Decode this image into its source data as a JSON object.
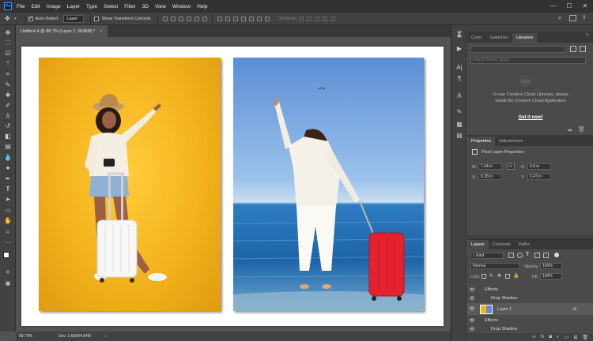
{
  "app": {
    "logo": "Ps"
  },
  "menu": [
    "File",
    "Edit",
    "Image",
    "Layer",
    "Type",
    "Select",
    "Filter",
    "3D",
    "View",
    "Window",
    "Help"
  ],
  "window_controls": {
    "minimize": "—",
    "maximize": "☐",
    "close": "✕"
  },
  "options_bar": {
    "auto_select_label": "Auto-Select:",
    "auto_select_checked": true,
    "auto_select_target": "Layer",
    "show_transform_label": "Show Transform Controls",
    "show_transform_checked": false,
    "mode_3d_label": "3D Mode:"
  },
  "document": {
    "tab_title": "Untitled-4 @ 88.7% (Layer 1, RGB/8) *",
    "tab_close": "×"
  },
  "status": {
    "zoom": "88.79%",
    "doc_info": "Doc: 2.65M/4.54M",
    "arrow": "›"
  },
  "libraries_panel": {
    "tabs": [
      "Color",
      "Swatches",
      "Libraries"
    ],
    "active_tab": "Libraries",
    "search_placeholder": "Search Adobe Stock",
    "message": "To use Creative Cloud Libraries, please install the Creative Cloud Application",
    "link": "Get it now!"
  },
  "properties_panel": {
    "tabs": [
      "Properties",
      "Adjustments"
    ],
    "active_tab": "Properties",
    "title": "Pixel Layer Properties",
    "w_label": "W:",
    "w_value": "7.44 in",
    "h_label": "H:",
    "h_value": "9.9 in",
    "x_label": "X:",
    "x_value": "8.28 in",
    "y_label": "Y:",
    "y_value": "0.47 in",
    "link_icon": "∞"
  },
  "layers_panel": {
    "tabs": [
      "Layers",
      "Channels",
      "Paths"
    ],
    "active_tab": "Layers",
    "filter_kind": "Kind",
    "blend_mode": "Normal",
    "opacity_label": "Opacity:",
    "opacity_value": "100%",
    "lock_label": "Lock:",
    "fill_label": "Fill:",
    "fill_value": "100%",
    "rows": [
      {
        "type": "effects",
        "label": "Effects"
      },
      {
        "type": "effect",
        "label": "Drop Shadow"
      },
      {
        "type": "layer",
        "label": "Layer 1",
        "fx": "fx"
      },
      {
        "type": "effects",
        "label": "Effects"
      },
      {
        "type": "effect",
        "label": "Drop Shadow"
      }
    ]
  },
  "colors": {
    "left_photo_bg": "#f3b31c",
    "right_sky_top": "#5a8fd4",
    "sea": "#1c64a8",
    "suitcase_red": "#e4222f",
    "accent_blue": "#31a8ff"
  },
  "icons": {
    "toolbar": [
      "move-icon",
      "marquee-icon",
      "lasso-icon",
      "magic-wand-icon",
      "crop-icon",
      "eyedropper-icon",
      "healing-icon",
      "brush-icon",
      "stamp-icon",
      "history-brush-icon",
      "eraser-icon",
      "gradient-icon",
      "blur-icon",
      "dodge-icon",
      "pen-icon",
      "type-icon",
      "path-select-icon",
      "shape-icon",
      "hand-icon",
      "zoom-icon",
      "more-icon"
    ]
  }
}
